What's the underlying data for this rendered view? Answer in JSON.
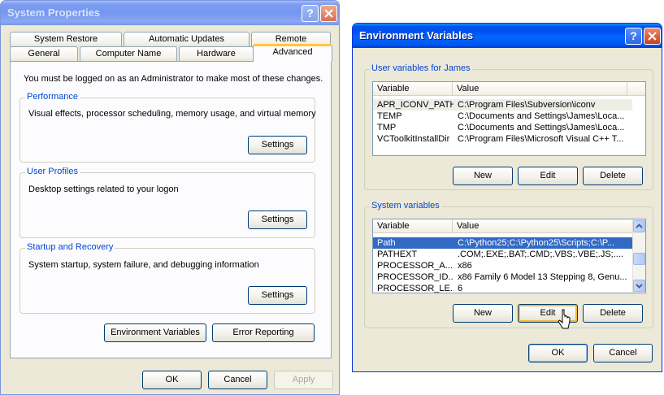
{
  "system_properties": {
    "title": "System Properties",
    "help_glyph": "?",
    "tabs_back": [
      "System Restore",
      "Automatic Updates",
      "Remote"
    ],
    "tabs_front": [
      "General",
      "Computer Name",
      "Hardware",
      "Advanced"
    ],
    "active_tab": "Advanced",
    "admin_notice": "You must be logged on as an Administrator to make most of these changes.",
    "performance": {
      "label": "Performance",
      "description": "Visual effects, processor scheduling, memory usage, and virtual memory",
      "button": "Settings"
    },
    "user_profiles": {
      "label": "User Profiles",
      "description": "Desktop settings related to your logon",
      "button": "Settings"
    },
    "startup_recovery": {
      "label": "Startup and Recovery",
      "description": "System startup, system failure, and debugging information",
      "button": "Settings"
    },
    "env_vars_button": "Environment Variables",
    "error_reporting_button": "Error Reporting",
    "ok_button": "OK",
    "cancel_button": "Cancel",
    "apply_button": "Apply"
  },
  "environment_variables": {
    "title": "Environment Variables",
    "help_glyph": "?",
    "user_group_label": "User variables for James",
    "user_columns": [
      "Variable",
      "Value"
    ],
    "user_rows": [
      {
        "variable": "APR_ICONV_PATH",
        "value": "C:\\Program Files\\Subversion\\iconv"
      },
      {
        "variable": "TEMP",
        "value": "C:\\Documents and Settings\\James\\Loca..."
      },
      {
        "variable": "TMP",
        "value": "C:\\Documents and Settings\\James\\Loca..."
      },
      {
        "variable": "VCToolkitInstallDir",
        "value": "C:\\Program Files\\Microsoft Visual C++ T..."
      }
    ],
    "user_buttons": {
      "new": "New",
      "edit": "Edit",
      "delete": "Delete"
    },
    "system_group_label": "System variables",
    "system_columns": [
      "Variable",
      "Value"
    ],
    "system_rows": [
      {
        "variable": "Path",
        "value": "C:\\Python25;C:\\Python25\\Scripts;C:\\P...",
        "selected": true
      },
      {
        "variable": "PATHEXT",
        "value": ".COM;.EXE;.BAT;.CMD;.VBS;.VBE;.JS;...."
      },
      {
        "variable": "PROCESSOR_A...",
        "value": "x86"
      },
      {
        "variable": "PROCESSOR_ID...",
        "value": "x86 Family 6 Model 13 Stepping 8, Genu..."
      },
      {
        "variable": "PROCESSOR_LE...",
        "value": "6"
      }
    ],
    "system_buttons": {
      "new": "New",
      "edit": "Edit",
      "delete": "Delete"
    },
    "ok_button": "OK",
    "cancel_button": "Cancel"
  },
  "colors": {
    "titlebar_active": "#0054e3",
    "titlebar_inactive": "#7b9cf0",
    "dialog_face": "#ece9d8",
    "group_label": "#0046d5",
    "selection": "#316ac5",
    "tab_highlight": "#ffc73c"
  }
}
